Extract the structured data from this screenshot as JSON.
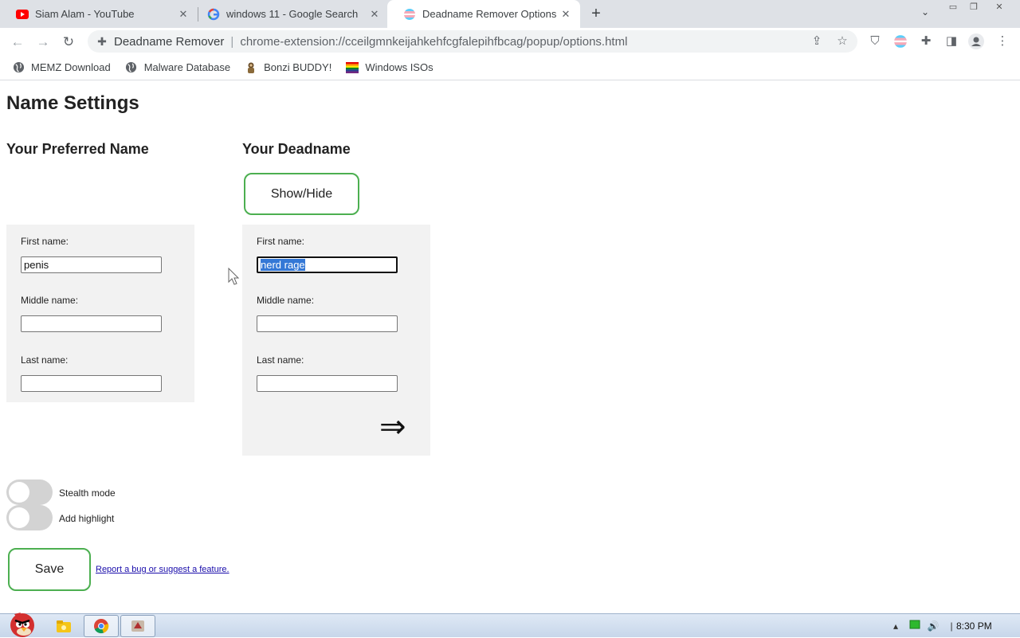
{
  "tabs": [
    {
      "title": "Siam Alam - YouTube",
      "icon": "youtube-icon"
    },
    {
      "title": "windows 11 - Google Search",
      "icon": "google-icon"
    },
    {
      "title": "Deadname Remover Options",
      "icon": "trans-flag-icon",
      "active": true
    }
  ],
  "toolbar": {
    "site_name": "Deadname Remover",
    "url": "chrome-extension://cceilgmnkeijahkehfcgfalepihfbcag/popup/options.html"
  },
  "bookmarks": [
    {
      "label": "MEMZ Download",
      "icon": "globe-icon"
    },
    {
      "label": "Malware Database",
      "icon": "globe-icon"
    },
    {
      "label": "Bonzi BUDDY!",
      "icon": "bonzi-icon"
    },
    {
      "label": "Windows ISOs",
      "icon": "rainbow-flag-icon"
    }
  ],
  "page": {
    "title": "Name Settings",
    "preferred_heading": "Your Preferred Name",
    "deadname_heading": "Your Deadname",
    "showhide_label": "Show/Hide",
    "preferred": {
      "first_label": "First name:",
      "first_value": "penis",
      "middle_label": "Middle name:",
      "middle_value": "",
      "last_label": "Last name:",
      "last_value": ""
    },
    "deadname": {
      "first_label": "First name:",
      "first_value": "nerd rage",
      "middle_label": "Middle name:",
      "middle_value": "",
      "last_label": "Last name:",
      "last_value": ""
    },
    "arrow": "⇒",
    "stealth_label": "Stealth mode",
    "highlight_label": "Add highlight",
    "save_label": "Save",
    "report_link": "Report a bug or suggest a feature."
  },
  "taskbar": {
    "clock": "8:30 PM"
  }
}
